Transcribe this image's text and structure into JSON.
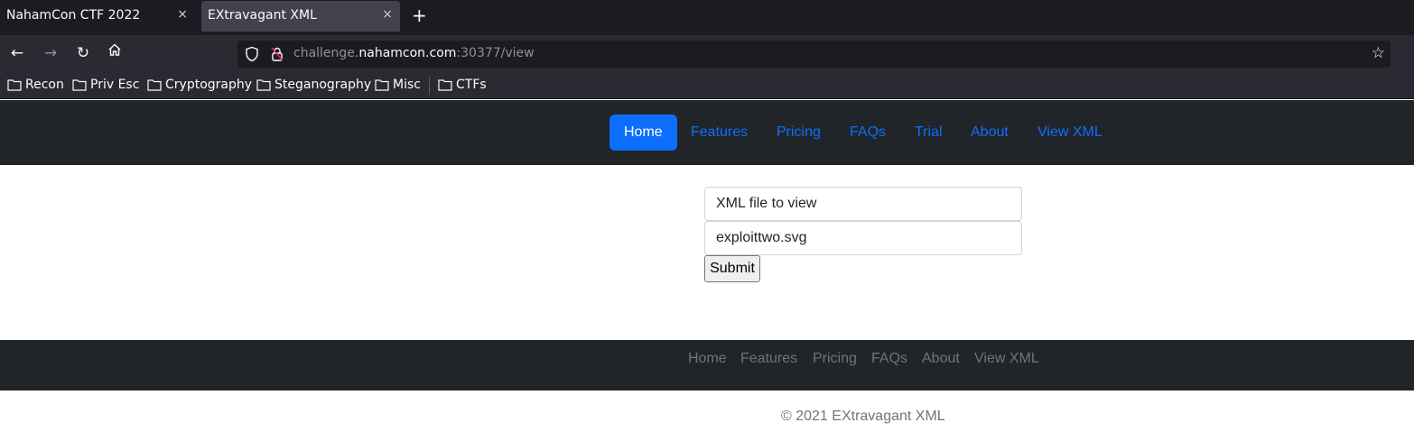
{
  "browser": {
    "tabs": [
      {
        "title": "NahamCon CTF 2022",
        "close": "×"
      },
      {
        "title": "EXtravagant XML",
        "close": "×"
      }
    ],
    "new_tab": "+",
    "url": {
      "prefix": "challenge.",
      "host": "nahamcon.com",
      "suffix": ":30377/view"
    },
    "bookmarks": [
      "Recon",
      "Priv Esc",
      "Cryptography",
      "Steganography",
      "Misc",
      "CTFs"
    ]
  },
  "site_nav": {
    "links": [
      "Home",
      "Features",
      "Pricing",
      "FAQs",
      "Trial",
      "About",
      "View XML"
    ],
    "active": "Home"
  },
  "form": {
    "label_field": "XML file to view",
    "file_field": "exploittwo.svg",
    "submit": "Submit"
  },
  "footer": {
    "links": [
      "Home",
      "Features",
      "Pricing",
      "FAQs",
      "About",
      "View XML"
    ],
    "copyright": "© 2021 EXtravagant XML"
  },
  "colors": {
    "primary": "#0d6efd",
    "navbar_bg": "#212529",
    "muted_text": "#6c757d",
    "browser_bg": "#1c1b22"
  }
}
